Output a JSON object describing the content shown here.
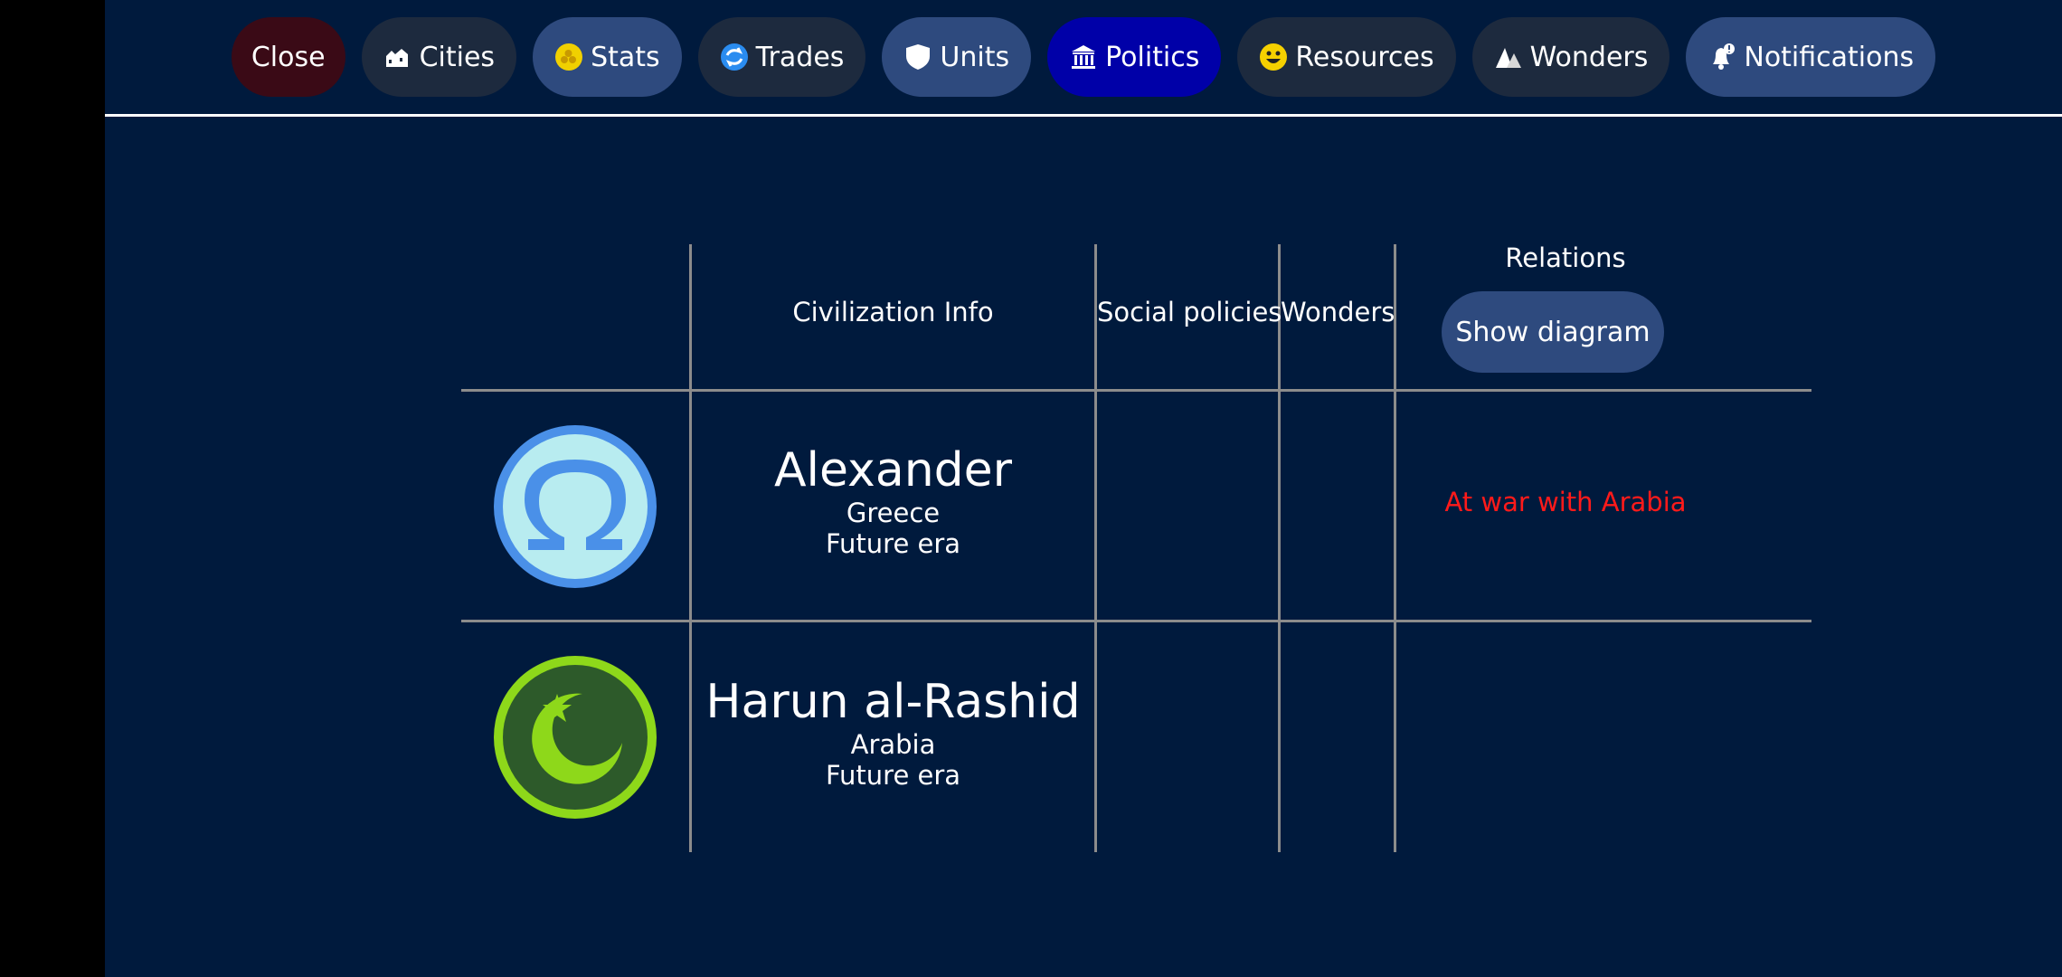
{
  "tabs": [
    {
      "name": "tab-close",
      "label": "Close",
      "icon": null,
      "style": "close"
    },
    {
      "name": "tab-cities",
      "label": "Cities",
      "icon": "cities-icon",
      "style": "dark"
    },
    {
      "name": "tab-stats",
      "label": "Stats",
      "icon": "stats-icon",
      "style": "blue"
    },
    {
      "name": "tab-trades",
      "label": "Trades",
      "icon": "trades-icon",
      "style": "dark"
    },
    {
      "name": "tab-units",
      "label": "Units",
      "icon": "shield-icon",
      "style": "blue"
    },
    {
      "name": "tab-politics",
      "label": "Politics",
      "icon": "politics-icon",
      "style": "active"
    },
    {
      "name": "tab-resources",
      "label": "Resources",
      "icon": "smiley-icon",
      "style": "dark"
    },
    {
      "name": "tab-wonders",
      "label": "Wonders",
      "icon": "wonders-icon",
      "style": "dark"
    },
    {
      "name": "tab-notifications",
      "label": "Notifications",
      "icon": "bell-icon",
      "style": "blue"
    }
  ],
  "table": {
    "headers": {
      "civ_info": "Civilization Info",
      "social_policies": "Social policies",
      "wonders": "Wonders",
      "relations": "Relations",
      "show_diagram": "Show diagram"
    },
    "rows": [
      {
        "leader": "Alexander",
        "civ": "Greece",
        "era": "Future era",
        "emblem": "omega-icon",
        "relation": "At war with Arabia"
      },
      {
        "leader": "Harun al-Rashid",
        "civ": "Arabia",
        "era": "Future era",
        "emblem": "crescent-star-icon",
        "relation": ""
      }
    ]
  },
  "colors": {
    "background": "#001a3d",
    "active_tab": "#0000a8",
    "war_text": "#ff1a1a",
    "greece_outer": "#4a90e8",
    "greece_inner": "#b8ecf0",
    "arabia_outer": "#8ed81a",
    "arabia_inner": "#2d5a2a"
  }
}
